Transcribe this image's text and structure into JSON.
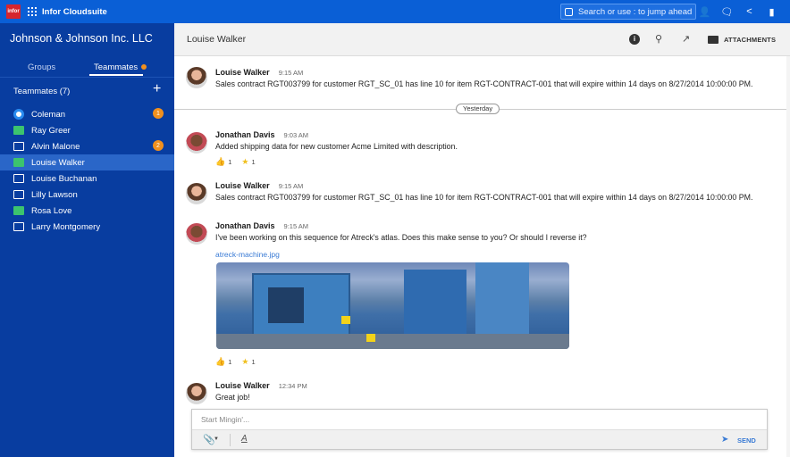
{
  "topbar": {
    "logo": "infor",
    "app_title": "Infor Cloudsuite",
    "search_placeholder": "Search or use : to jump ahead",
    "icons": [
      "person-icon",
      "chat-icon",
      "share-icon",
      "bookmark-icon"
    ]
  },
  "sidebar": {
    "company": "Johnson & Johnson Inc. LLC",
    "tabs": [
      "Groups",
      "Teammates"
    ],
    "active_tab": "Teammates",
    "section_title": "Teammates (7)",
    "teammates": [
      {
        "name": "Coleman",
        "status": "circle",
        "badge": "1"
      },
      {
        "name": "Ray Greer",
        "status": "online",
        "badge": ""
      },
      {
        "name": "Alvin Malone",
        "status": "offline",
        "badge": "2"
      },
      {
        "name": "Louise Walker",
        "status": "online",
        "badge": "",
        "active": true
      },
      {
        "name": "Louise Buchanan",
        "status": "offline",
        "badge": ""
      },
      {
        "name": "Lilly Lawson",
        "status": "offline",
        "badge": ""
      },
      {
        "name": "Rosa Love",
        "status": "online",
        "badge": ""
      },
      {
        "name": "Larry Montgomery",
        "status": "offline",
        "badge": ""
      }
    ]
  },
  "chat": {
    "title": "Louise Walker",
    "attachments_label": "ATTACHMENTS",
    "divider_label": "Yesterday",
    "messages": [
      {
        "sender": "Louise Walker",
        "time": "9:15 AM",
        "text": "Sales contract RGT003799 for customer RGT_SC_01 has line 10 for item RGT-CONTRACT-001 that will expire within 14 days on 8/27/2014 10:00:00 PM."
      },
      {
        "sender": "Jonathan Davis",
        "time": "9:03 AM",
        "text": "Added shipping data for new customer Acme Limited with description.",
        "likes": "1",
        "stars": "1"
      },
      {
        "sender": "Louise Walker",
        "time": "9:15 AM",
        "text": "Sales contract RGT003799 for customer RGT_SC_01 has line 10 for item RGT-CONTRACT-001 that will expire within 14 days on 8/27/2014 10:00:00 PM."
      },
      {
        "sender": "Jonathan Davis",
        "time": "9:15 AM",
        "text": "I've been working on this sequence for Atreck's atlas. Does this make sense to you? Or should I reverse it?",
        "file": "atreck-machine.jpg",
        "likes": "1",
        "stars": "1"
      },
      {
        "sender": "Louise Walker",
        "time": "12:34 PM",
        "text": "Great job!"
      }
    ]
  },
  "composer": {
    "placeholder": "Start Mingin'...",
    "format_label": "A",
    "send_label": "SEND"
  }
}
